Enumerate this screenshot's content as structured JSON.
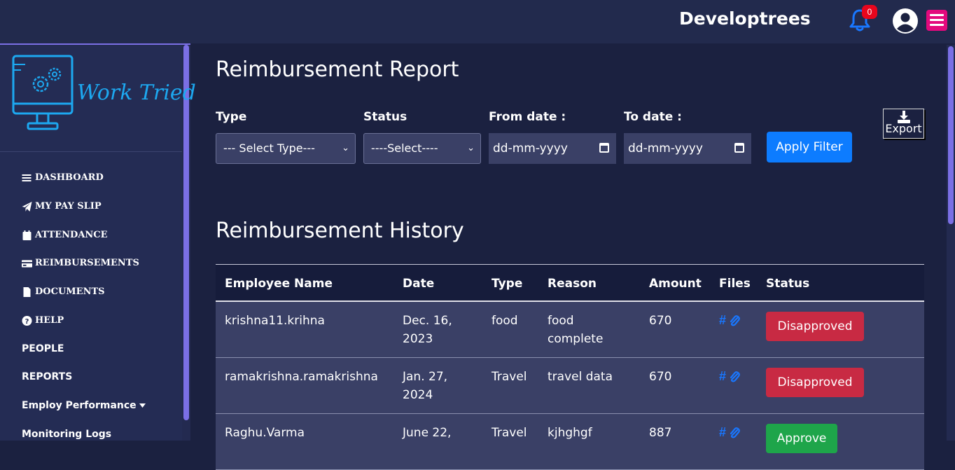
{
  "header": {
    "brand": "Developtrees",
    "notification_count": "0"
  },
  "sidebar": {
    "logo_text": "Work Tried",
    "items": [
      {
        "label": "DASHBOARD",
        "icon": "bars-icon"
      },
      {
        "label": "MY PAY SLIP",
        "icon": "paper-plane-icon"
      },
      {
        "label": "ATTENDANCE",
        "icon": "calendar-icon"
      },
      {
        "label": "REIMBURSEMENTS",
        "icon": "credit-card-icon"
      },
      {
        "label": "DOCUMENTS",
        "icon": "file-icon"
      },
      {
        "label": "HELP",
        "icon": "question-circle-icon"
      },
      {
        "label": "PEOPLE"
      },
      {
        "label": "REPORTS"
      },
      {
        "label": "Employ Performance",
        "icon": "caret-down-icon"
      },
      {
        "label": "Monitoring Logs"
      }
    ]
  },
  "main": {
    "title": "Reimbursement Report",
    "filters": {
      "type_label": "Type",
      "type_value": "--- Select Type---",
      "status_label": "Status",
      "status_value": "----Select----",
      "from_label": "From date :",
      "from_value": "dd-mm-yyyy",
      "to_label": "To date :",
      "to_value": "dd-mm-yyyy",
      "apply_label": "Apply Filter",
      "export_label": "Export"
    },
    "history_title": "Reimbursement History",
    "table": {
      "columns": [
        "Employee Name",
        "Date",
        "Type",
        "Reason",
        "Amount",
        "Files",
        "Status"
      ],
      "rows": [
        {
          "name": "krishna11.krihna",
          "date": "Dec. 16, 2023",
          "type": "food",
          "reason": "food complete",
          "amount": "670",
          "files": "#",
          "status": "Disapproved"
        },
        {
          "name": "ramakrishna.ramakrishna",
          "date": "Jan. 27, 2024",
          "type": "Travel",
          "reason": "travel data",
          "amount": "670",
          "files": "#",
          "status": "Disapproved"
        },
        {
          "name": "Raghu.Varma",
          "date": "June 22,",
          "type": "Travel",
          "reason": "kjhghgf",
          "amount": "887",
          "files": "#",
          "status": "Approve"
        }
      ]
    }
  },
  "colors": {
    "background": "#1b2140",
    "topbar": "#222a4d",
    "accent": "#7b6fe5",
    "primary_button": "#0d7cff",
    "danger": "#c82a43",
    "success": "#1ea54a",
    "menu_button": "#e3097d"
  }
}
